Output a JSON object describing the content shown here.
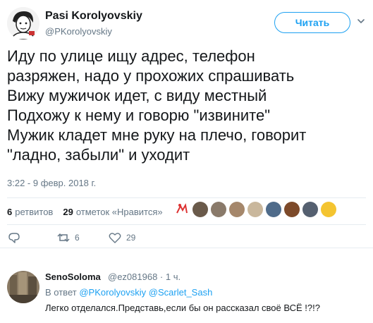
{
  "tweet": {
    "author_name": "Pasi Korolyovskiy",
    "author_handle": "@PKorolyovskiy",
    "follow_label": "Читать",
    "lines": [
      "Иду по улице ищу адрес, телефон",
      "разряжен, надо у прохожих спрашивать",
      "Вижу мужичок идет, с виду местный",
      "Подхожу к нему и говорю \"извините\"",
      "Мужик кладет мне руку на плечо, говорит",
      "\"ладно, забыли\" и уходит"
    ],
    "timestamp": "3:22 - 9 февр. 2018 г.",
    "retweets_count": "6",
    "retweets_label": "ретвитов",
    "likes_count": "29",
    "likes_label": "отметок «Нравится»",
    "actions": {
      "reply_icon": "reply-icon",
      "retweet_count": "6",
      "like_count": "29"
    }
  },
  "reply": {
    "author_name": "SenoSoloma",
    "meta": "@ez081968 · 1 ч.",
    "reply_to_prefix": "В ответ",
    "reply_to_1": "@PKorolyovskiy",
    "reply_to_2": "@Scarlet_Sash",
    "text": "Легко отделался.Представь,если бы он рассказал своё ВСЁ !?!?"
  },
  "colors": {
    "accent": "#1da1f2",
    "muted": "#657786",
    "text": "#14171a",
    "divider": "#e6ecf0"
  }
}
